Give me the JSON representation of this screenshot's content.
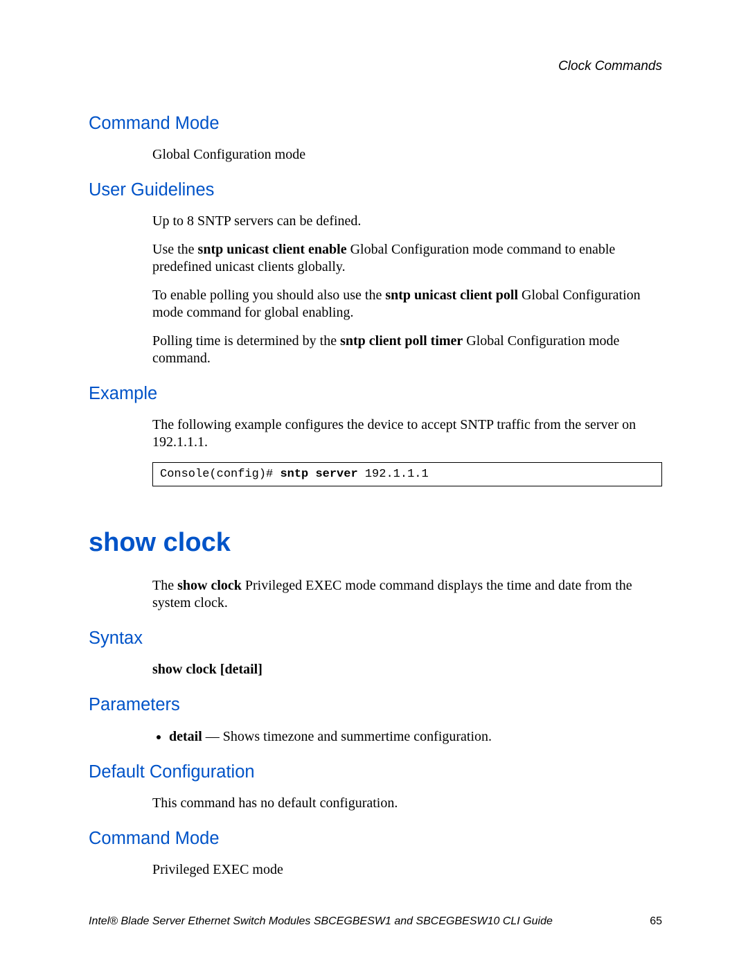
{
  "running_head": "Clock Commands",
  "s1": {
    "heading": "Command Mode",
    "body": "Global Configuration mode"
  },
  "s2": {
    "heading": "User Guidelines",
    "p1": "Up to 8 SNTP servers can be defined.",
    "p2_a": "Use the ",
    "p2_b": "sntp unicast client enable",
    "p2_c": " Global Configuration mode command to enable predefined unicast clients globally.",
    "p3_a": "To enable polling you should also use the ",
    "p3_b": "sntp unicast client poll",
    "p3_c": " Global Configuration mode command for global enabling.",
    "p4_a": "Polling time is determined by the ",
    "p4_b": "sntp client poll timer",
    "p4_c": " Global Configuration mode command."
  },
  "s3": {
    "heading": "Example",
    "p1": "The following example configures the device to accept SNTP traffic from the server on 192.1.1.1.",
    "code_prompt": "Console(config)# ",
    "code_cmd": "sntp server",
    "code_arg": " 192.1.1.1"
  },
  "cmd": {
    "title": "show clock",
    "intro_a": "The ",
    "intro_b": "show clock",
    "intro_c": " Privileged EXEC mode command displays the time and date from the system clock."
  },
  "s4": {
    "heading": "Syntax",
    "line": "show clock [detail]"
  },
  "s5": {
    "heading": "Parameters",
    "item_b": "detail",
    "item_rest": " — Shows timezone and summertime configuration."
  },
  "s6": {
    "heading": "Default Configuration",
    "body": "This command has no default configuration."
  },
  "s7": {
    "heading": "Command Mode",
    "body": "Privileged EXEC mode"
  },
  "footer": {
    "text": "Intel® Blade Server Ethernet Switch Modules SBCEGBESW1 and SBCEGBESW10 CLI Guide",
    "page": "65"
  }
}
